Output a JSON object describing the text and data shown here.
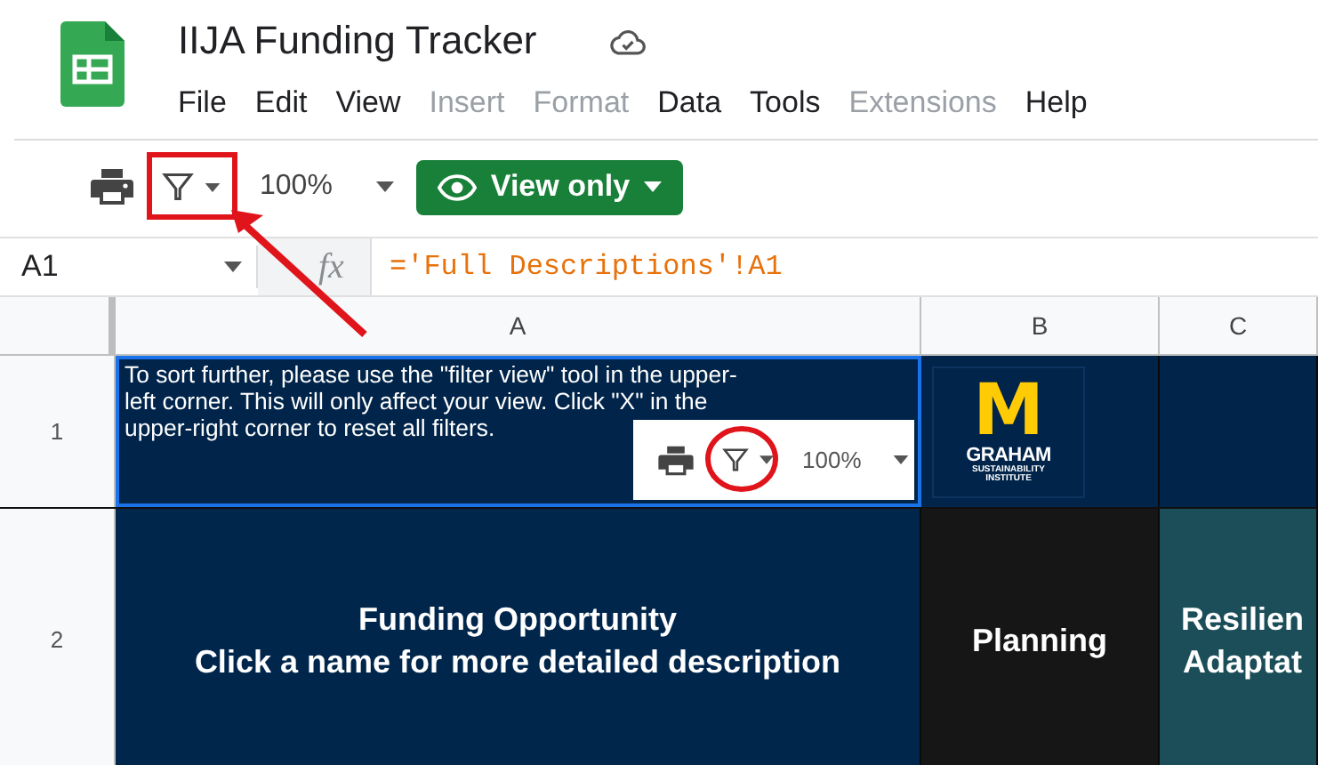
{
  "document": {
    "title": "IIJA Funding Tracker"
  },
  "menu": [
    {
      "label": "File",
      "disabled": false
    },
    {
      "label": "Edit",
      "disabled": false
    },
    {
      "label": "View",
      "disabled": false
    },
    {
      "label": "Insert",
      "disabled": true
    },
    {
      "label": "Format",
      "disabled": true
    },
    {
      "label": "Data",
      "disabled": false
    },
    {
      "label": "Tools",
      "disabled": false
    },
    {
      "label": "Extensions",
      "disabled": true
    },
    {
      "label": "Help",
      "disabled": false
    }
  ],
  "toolbar": {
    "zoom": "100%",
    "view_button": "View only"
  },
  "formula_bar": {
    "cell_ref": "A1",
    "fx": "fx",
    "formula": "='Full Descriptions'!A1"
  },
  "columns": [
    "A",
    "B",
    "C"
  ],
  "rows": [
    {
      "number": "1",
      "cells": [
        {
          "kind": "note",
          "selected": true,
          "color": "#00244a",
          "text": "To sort further, please use the \"filter view\" tool in the upper-left corner. This will only affect your view. Click \"X\" in the upper-right corner to reset all filters.",
          "inset_zoom": "100%"
        },
        {
          "kind": "logo",
          "selected": false,
          "color": "#00244a",
          "mark": "M",
          "name": "GRAHAM",
          "subtitle": "SUSTAINABILITY",
          "subtitle_2": "INSTITUTE"
        },
        {
          "kind": "empty",
          "selected": false,
          "color": "#00244a"
        }
      ]
    },
    {
      "number": "2",
      "cells": [
        {
          "kind": "heading",
          "selected": false,
          "color": "#00264c",
          "text": "Funding Opportunity\nClick a name for more detailed description"
        },
        {
          "kind": "heading",
          "selected": false,
          "color": "#161616",
          "text": "Planning"
        },
        {
          "kind": "cutoff",
          "selected": false,
          "color": "#1b4e58",
          "text": "Resilien\nAdaptat"
        }
      ]
    }
  ]
}
